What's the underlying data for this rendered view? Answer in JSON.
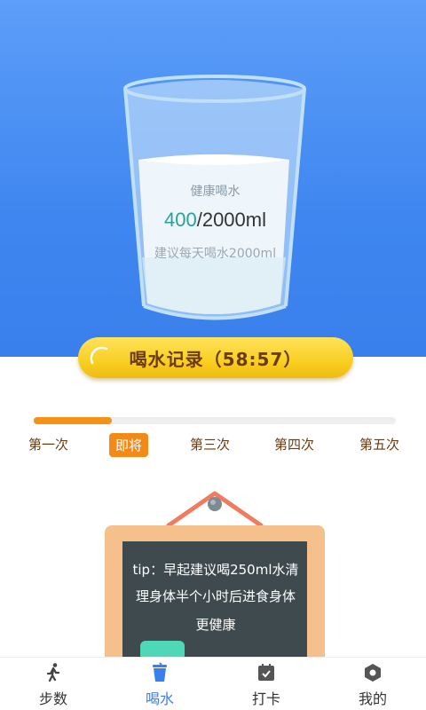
{
  "glass": {
    "title": "健康喝水",
    "current": "400",
    "goal": "/2000ml",
    "hint": "建议每天喝水2000ml",
    "fill_fraction": 0.2
  },
  "record_button": {
    "label": "喝水记录（58:57）"
  },
  "progress": {
    "fraction": 0.215,
    "color": "#f39217"
  },
  "steps": [
    {
      "label": "第一次",
      "active": false
    },
    {
      "label": "即将",
      "active": true
    },
    {
      "label": "第三次",
      "active": false
    },
    {
      "label": "第四次",
      "active": false
    },
    {
      "label": "第五次",
      "active": false
    }
  ],
  "tip": {
    "line1": "tip：早起建议喝250ml水清",
    "line2": "理身体半个小时后进食身体",
    "line3": "更健康"
  },
  "tabs": [
    {
      "label": "步数",
      "icon": "walking-person-icon",
      "active": false
    },
    {
      "label": "喝水",
      "icon": "cup-icon",
      "active": true
    },
    {
      "label": "打卡",
      "icon": "calendar-check-icon",
      "active": false
    },
    {
      "label": "我的",
      "icon": "settings-hexagon-icon",
      "active": false
    }
  ],
  "colors": {
    "primary": "#3a80ec",
    "accent": "#f39217",
    "brown": "#6b3b14",
    "chalkboard": "#3f4a4e"
  }
}
